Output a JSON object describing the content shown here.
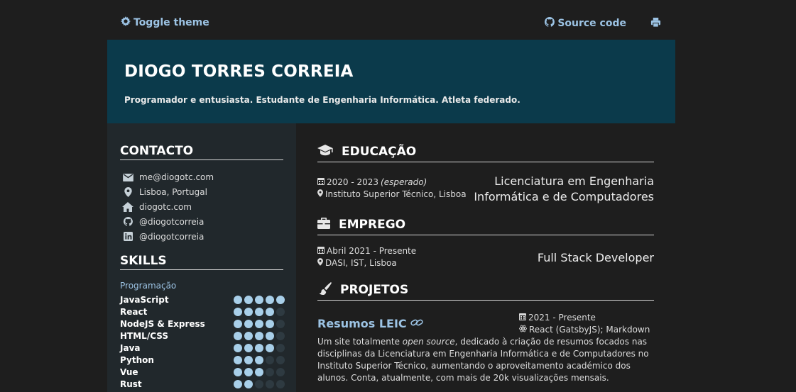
{
  "topbar": {
    "toggle_label": "Toggle theme",
    "source_label": "Source code"
  },
  "header": {
    "name": "DIOGO TORRES CORREIA",
    "tagline": "Programador e entusiasta. Estudante de Engenharia Informática. Atleta federado."
  },
  "sidebar": {
    "contact_title": "CONTACTO",
    "contact": [
      {
        "icon": "envelope-icon",
        "text": "me@diogotc.com"
      },
      {
        "icon": "map-marker-icon",
        "text": "Lisboa, Portugal"
      },
      {
        "icon": "home-icon",
        "text": "diogotc.com"
      },
      {
        "icon": "github-icon",
        "text": "@diogotcorreia"
      },
      {
        "icon": "linkedin-icon",
        "text": "@diogotcorreia"
      }
    ],
    "skills_title": "SKILLS",
    "skills_category": "Programação",
    "skills": [
      {
        "name": "JavaScript",
        "level": 5
      },
      {
        "name": "React",
        "level": 4
      },
      {
        "name": "NodeJS & Express",
        "level": 4
      },
      {
        "name": "HTML/CSS",
        "level": 4
      },
      {
        "name": "Java",
        "level": 4
      },
      {
        "name": "Python",
        "level": 3
      },
      {
        "name": "Vue",
        "level": 3
      },
      {
        "name": "Rust",
        "level": 2
      }
    ],
    "skills_max": 5
  },
  "main": {
    "education_title": "EDUCAÇÃO",
    "education": {
      "dates": "2020 - 2023",
      "dates_note": "(esperado)",
      "place": "Instituto Superior Técnico, Lisboa",
      "degree_line1": "Licenciatura em Engenharia",
      "degree_line2": "Informática e de Computadores"
    },
    "employment_title": "EMPREGO",
    "employment": {
      "dates": "Abril 2021 - Presente",
      "place": "DASI, IST, Lisboa",
      "role": "Full Stack Developer"
    },
    "projects_title": "PROJETOS",
    "project": {
      "name": "Resumos LEIC",
      "dates": "2021 - Presente",
      "tech": "React (GatsbyJS); Markdown",
      "desc_before": "Um site totalmente ",
      "desc_em": "open source",
      "desc_after": ", dedicado à criação de resumos focados nas disciplinas da Licenciatura em Engenharia Informática e de Computadores no Instituto Superior Técnico, aumentando o aproveitamento académico dos alunos. Conta, atualmente, com mais de 20k visualizações mensais."
    }
  },
  "colors": {
    "background": "#1e1e1e",
    "header": "#0b3a4b",
    "sidebar": "#21282c",
    "accent": "#9cc3e4",
    "dot_on": "#a8cfe9",
    "dot_off": "#2e3a41"
  }
}
